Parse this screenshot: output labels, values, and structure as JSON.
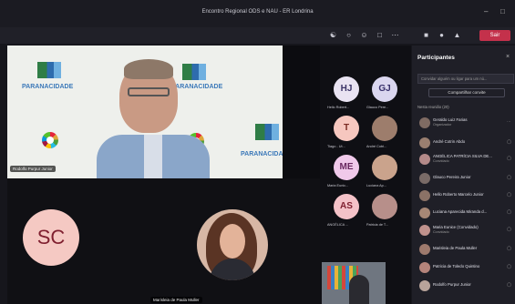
{
  "window": {
    "title": "Encontro Regional ODS e NAU - ER Londrina",
    "minimize": "–",
    "maximize": "□"
  },
  "toolbar": {
    "leave_label": "Sair"
  },
  "stage": {
    "speaker_name": "Rodolfo Purpur Junior",
    "logo_text": "PARANACIDADE",
    "bottom_name": "Marisleia de Paula Muller",
    "sc_initials": "SC"
  },
  "thumbnails": [
    {
      "initials": "HJ",
      "label": "Hello Robert...",
      "bg": "#e9e3f2",
      "fg": "#3b3467"
    },
    {
      "initials": "GJ",
      "label": "Glauco Pere...",
      "bg": "#dad6ef",
      "fg": "#38306b"
    },
    {
      "initials": "T",
      "label": "Tiago - Ut...",
      "bg": "#f6c7bf",
      "fg": "#7a2a22"
    },
    {
      "initials": "",
      "label": "André Cotri...",
      "bg": "#9d7d6c",
      "fg": "#000"
    },
    {
      "initials": "ME",
      "label": "Maria Eunic...",
      "bg": "#f0c9ea",
      "fg": "#6a2860"
    },
    {
      "initials": "",
      "label": "Luciana Ap...",
      "bg": "#caa38c",
      "fg": "#000"
    },
    {
      "initials": "AS",
      "label": "ANGÉLICA ...",
      "bg": "#f4c2c8",
      "fg": "#7f1f2f"
    },
    {
      "initials": "",
      "label": "Patricia de T...",
      "bg": "#b78f8a",
      "fg": "#000"
    }
  ],
  "panel": {
    "title": "Participantes",
    "close": "×",
    "invite_placeholder": "Convidar alguém ou ligar para um nú...",
    "share_label": "Compartilhar convite",
    "section_label": "Nesta reunião (20)"
  },
  "participants": [
    {
      "name": "Geraldo Luiz Farias",
      "role": "Organizador"
    },
    {
      "name": "André Cotrin Abdo",
      "role": ""
    },
    {
      "name": "ANGÉLICA PATRÍCIA SILVA DE...",
      "role": "Convidado"
    },
    {
      "name": "Glauco Pereira Junior",
      "role": ""
    },
    {
      "name": "Hello Roberto Marcelo Junior",
      "role": ""
    },
    {
      "name": "Luciana Aparecida Miranda d...",
      "role": ""
    },
    {
      "name": "Maria Eunice (Convidado)",
      "role": "Convidado"
    },
    {
      "name": "Marisleia de Paula Muller",
      "role": ""
    },
    {
      "name": "Patricia de Toledo Quintino",
      "role": ""
    },
    {
      "name": "Rodolfo Purpur Junior",
      "role": ""
    }
  ]
}
